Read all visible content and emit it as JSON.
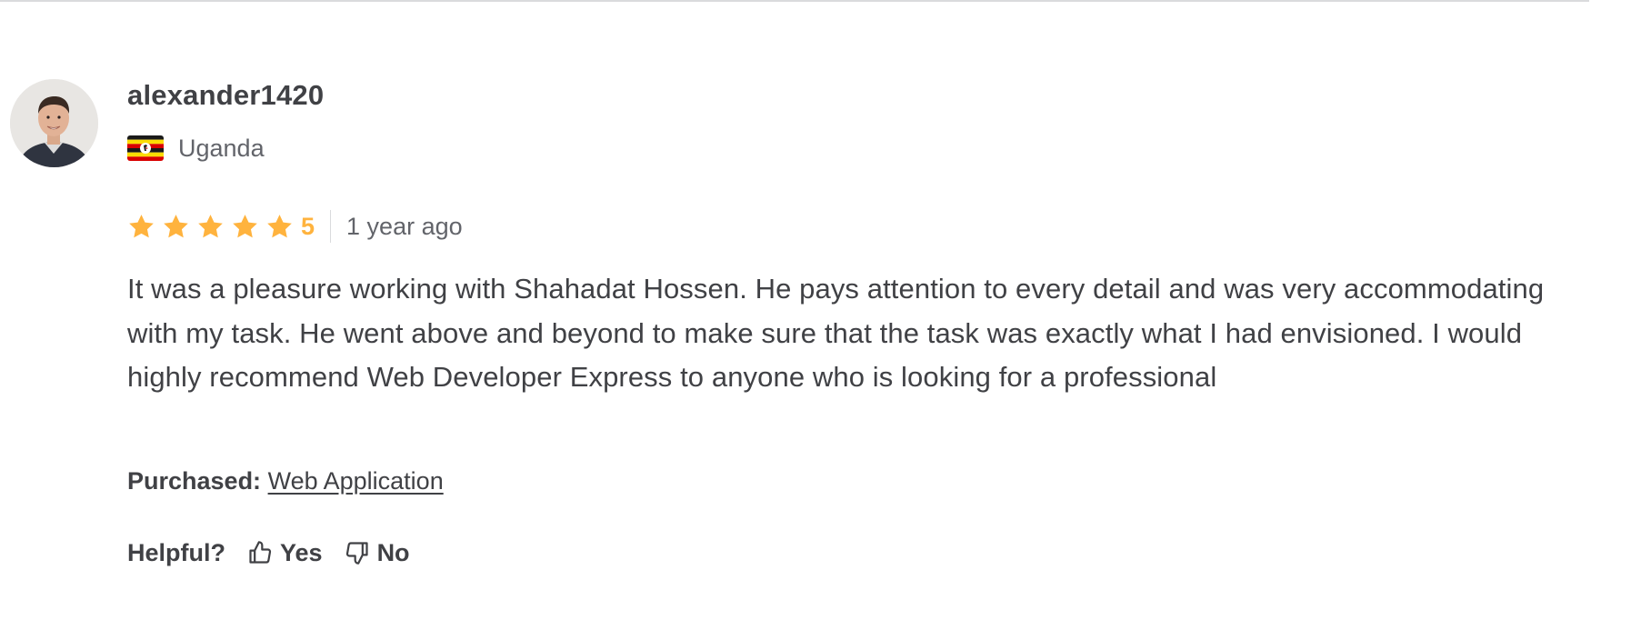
{
  "review": {
    "username": "alexander1420",
    "country": "Uganda",
    "rating": {
      "stars": 5,
      "score_text": "5",
      "star_color": "#ffb33e"
    },
    "time_ago": "1 year ago",
    "text": "It was a pleasure working with Shahadat Hossen. He pays attention to every detail and was very accommodating with my task. He went above and beyond to make sure that the task was exactly what I had envisioned. I would highly recommend Web Developer Express to anyone who is looking for a professional",
    "purchased": {
      "label": "Purchased:",
      "item": "Web Application"
    },
    "helpful": {
      "label": "Helpful?",
      "yes": "Yes",
      "no": "No"
    }
  },
  "icons": {
    "star": "star-icon",
    "thumbs_up": "thumbs-up-icon",
    "thumbs_down": "thumbs-down-icon",
    "flag": "uganda-flag-icon"
  },
  "colors": {
    "text_primary": "#404145",
    "text_secondary": "#62646a",
    "divider": "#dadbdd"
  }
}
